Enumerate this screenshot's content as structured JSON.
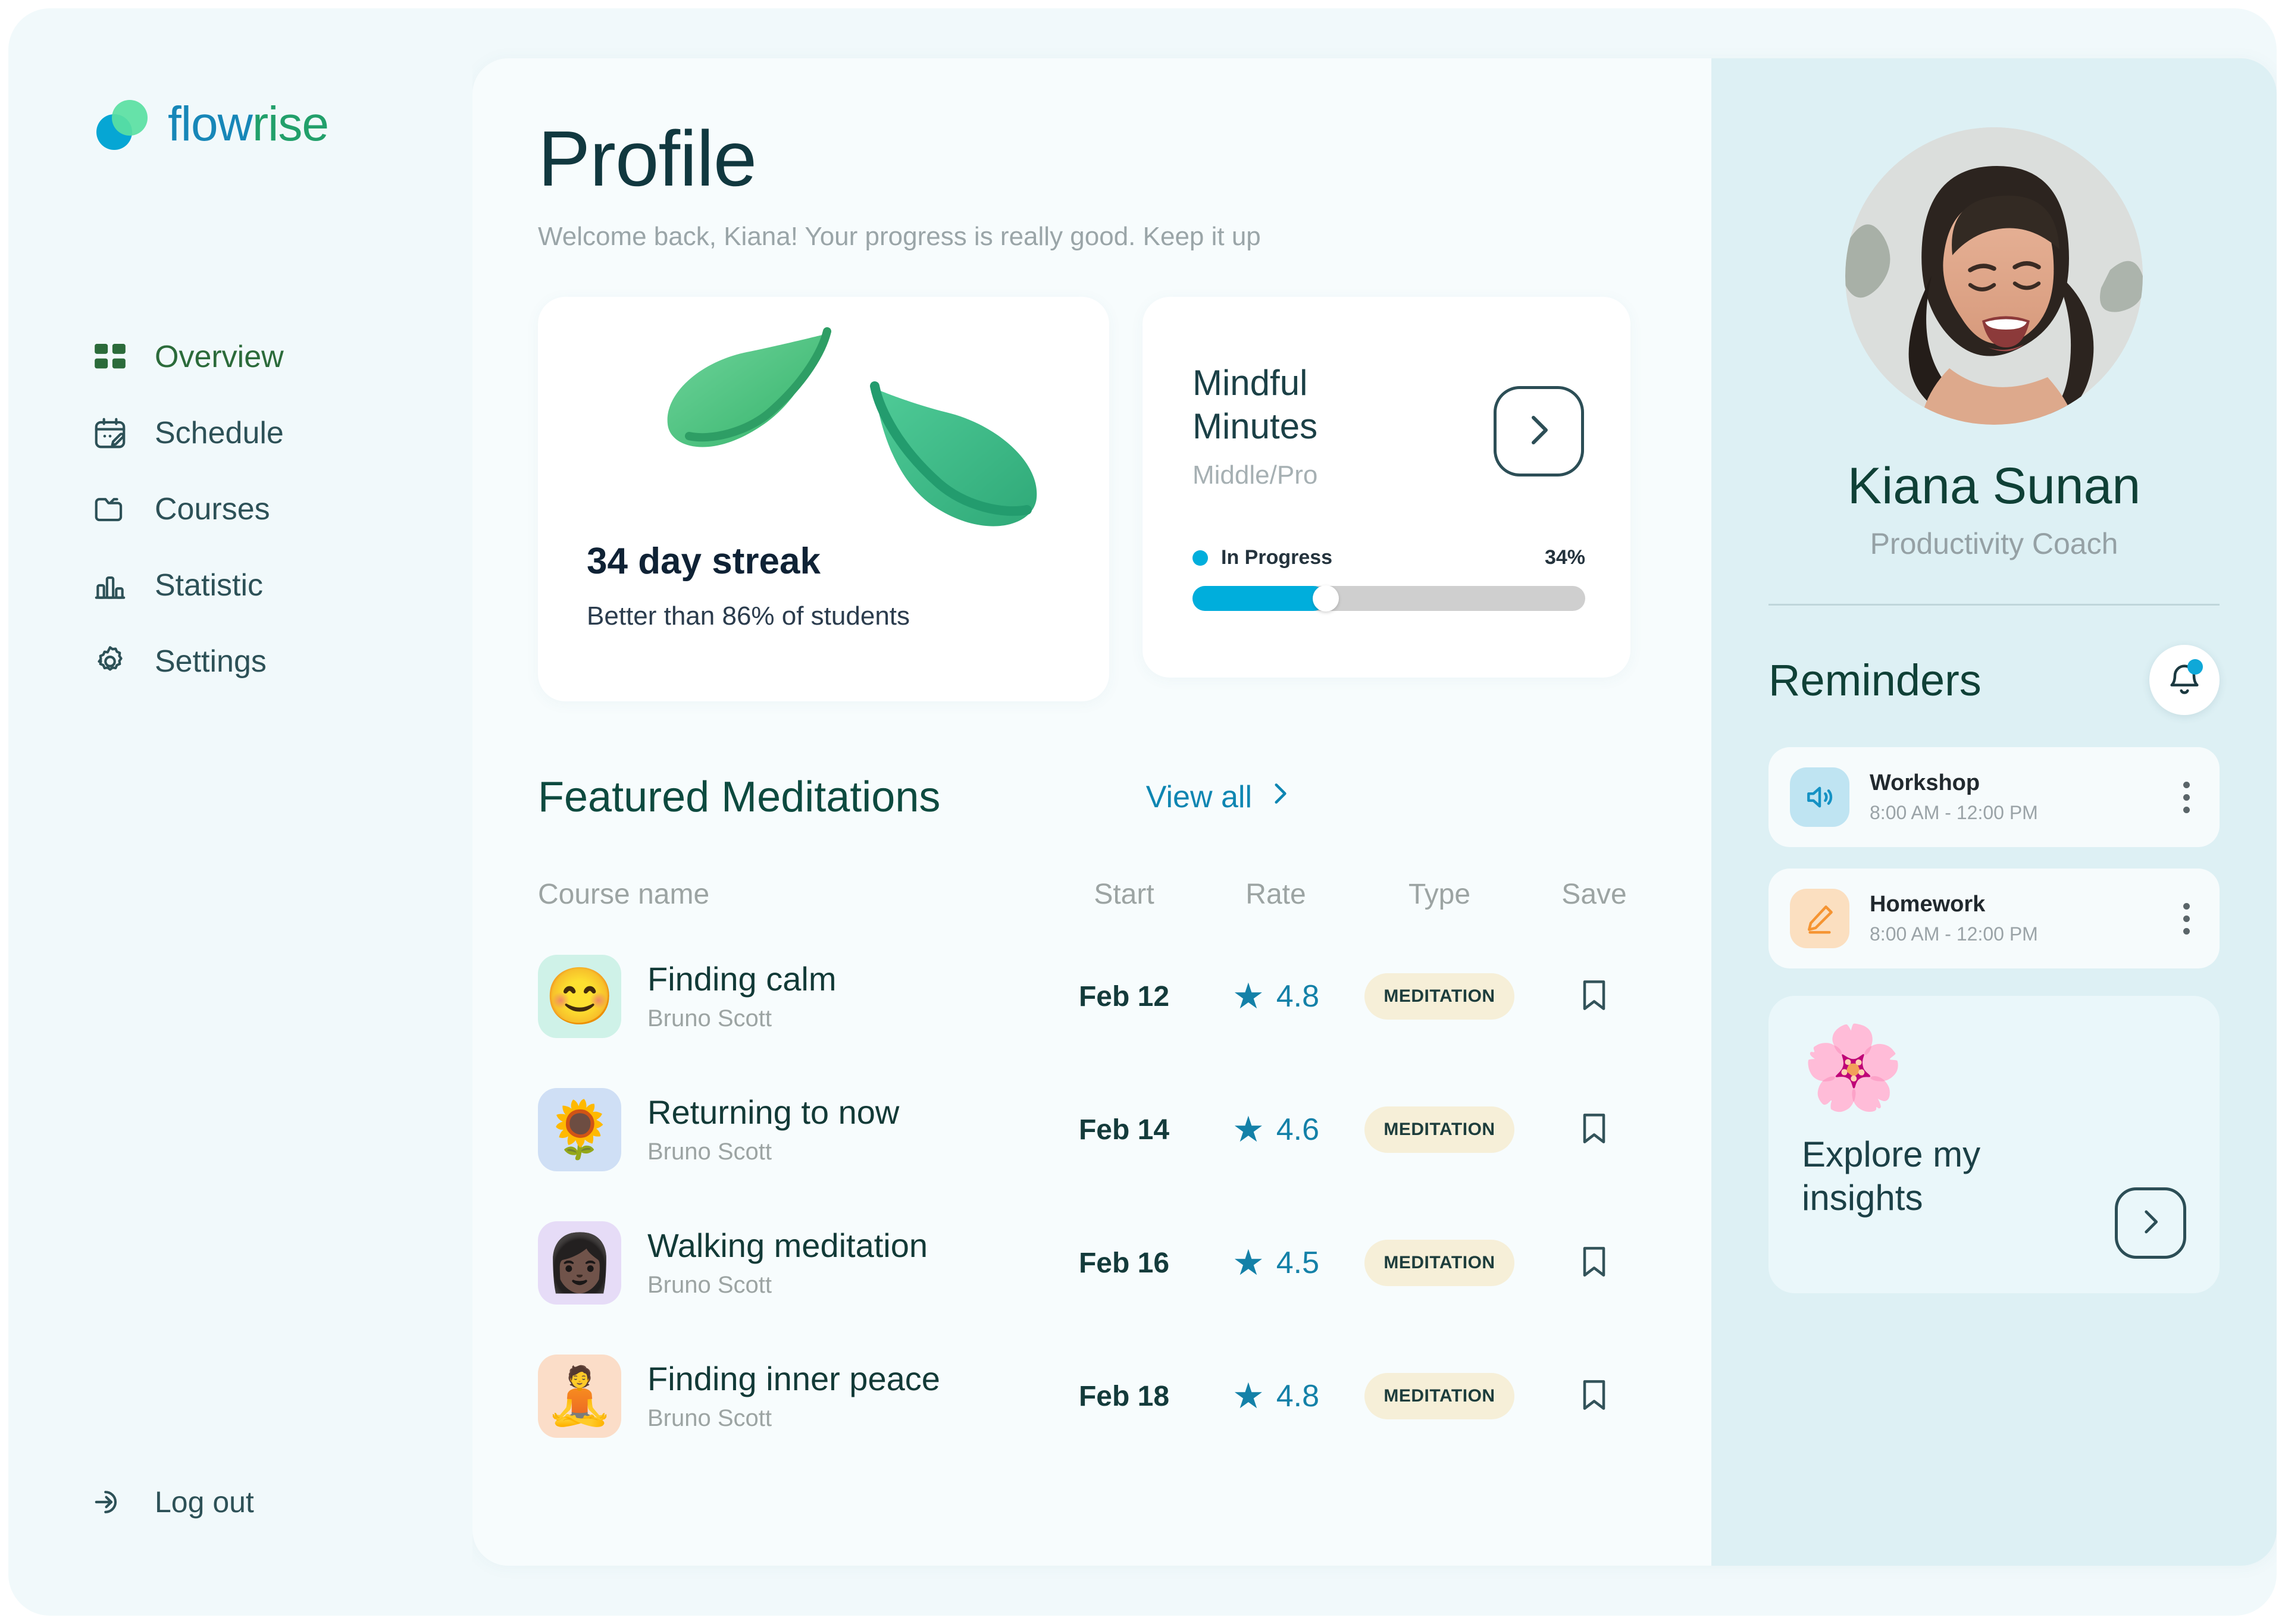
{
  "brand": {
    "part1": "flow",
    "part2": "rise"
  },
  "sidebar": {
    "items": [
      {
        "label": "Overview",
        "icon": "grid-icon",
        "active": true
      },
      {
        "label": "Schedule",
        "icon": "calendar-edit-icon",
        "active": false
      },
      {
        "label": "Courses",
        "icon": "folder-icon",
        "active": false
      },
      {
        "label": "Statistic",
        "icon": "bar-chart-icon",
        "active": false
      },
      {
        "label": "Settings",
        "icon": "gear-icon",
        "active": false
      }
    ],
    "logout_label": "Log out",
    "logout_icon": "logout-icon"
  },
  "header": {
    "title": "Profile",
    "subtitle": "Welcome back, Kiana! Your progress is really good. Keep it up"
  },
  "streak_card": {
    "emoji": "leaves",
    "title": "34 day streak",
    "subtitle": "Better than 86% of students"
  },
  "mindful_card": {
    "title_line1": "Mindful",
    "title_line2": "Minutes",
    "level": "Middle/Pro",
    "arrow_icon": "chevron-right-icon",
    "status": "In Progress",
    "percent_label": "34%",
    "percent_value": 34,
    "accent_color": "#00AEDC"
  },
  "featured": {
    "title": "Featured Meditations",
    "view_all_label": "View all",
    "view_all_icon": "chevron-right-icon",
    "columns": [
      "Course name",
      "Start",
      "Rate",
      "Type",
      "Save"
    ],
    "rows": [
      {
        "emoji": "😊",
        "thumb_bg": "#CFF2E8",
        "name": "Finding calm",
        "author": "Bruno Scott",
        "start": "Feb 12",
        "rate": "4.8",
        "type": "MEDITATION",
        "saved": false
      },
      {
        "emoji": "🌻",
        "thumb_bg": "#CFDFF5",
        "name": "Returning to now",
        "author": "Bruno Scott",
        "start": "Feb 14",
        "rate": "4.6",
        "type": "MEDITATION",
        "saved": false
      },
      {
        "emoji": "👩🏿",
        "thumb_bg": "#E6DCF7",
        "name": "Walking meditation",
        "author": "Bruno Scott",
        "start": "Feb 16",
        "rate": "4.5",
        "type": "MEDITATION",
        "saved": false
      },
      {
        "emoji": "🧘",
        "thumb_bg": "#FBDDC8",
        "name": "Finding inner peace",
        "author": "Bruno Scott",
        "start": "Feb 18",
        "rate": "4.8",
        "type": "MEDITATION",
        "saved": false
      }
    ]
  },
  "profile": {
    "name": "Kiana Sunan",
    "role": "Productivity Coach",
    "avatar_alt": "smiling-woman-photo"
  },
  "reminders": {
    "title": "Reminders",
    "bell_icon": "bell-icon",
    "items": [
      {
        "icon": "speaker-icon",
        "icon_bg": "#BFE4F2",
        "icon_color": "#1592C4",
        "name": "Workshop",
        "time": "8:00 AM - 12:00 PM"
      },
      {
        "icon": "pencil-icon",
        "icon_bg": "#FBDFC0",
        "icon_color": "#F59432",
        "name": "Homework",
        "time": "8:00 AM - 12:00 PM"
      }
    ]
  },
  "insights": {
    "emoji": "🌸",
    "line1": "Explore my",
    "line2": "insights",
    "arrow_icon": "chevron-right-icon"
  },
  "colors": {
    "page_bg": "#F1F9FB",
    "panel_bg": "#DDF0F4",
    "accent_cyan": "#00AEDC",
    "accent_green": "#0F4036",
    "badge_bg": "#F6EFD8"
  }
}
